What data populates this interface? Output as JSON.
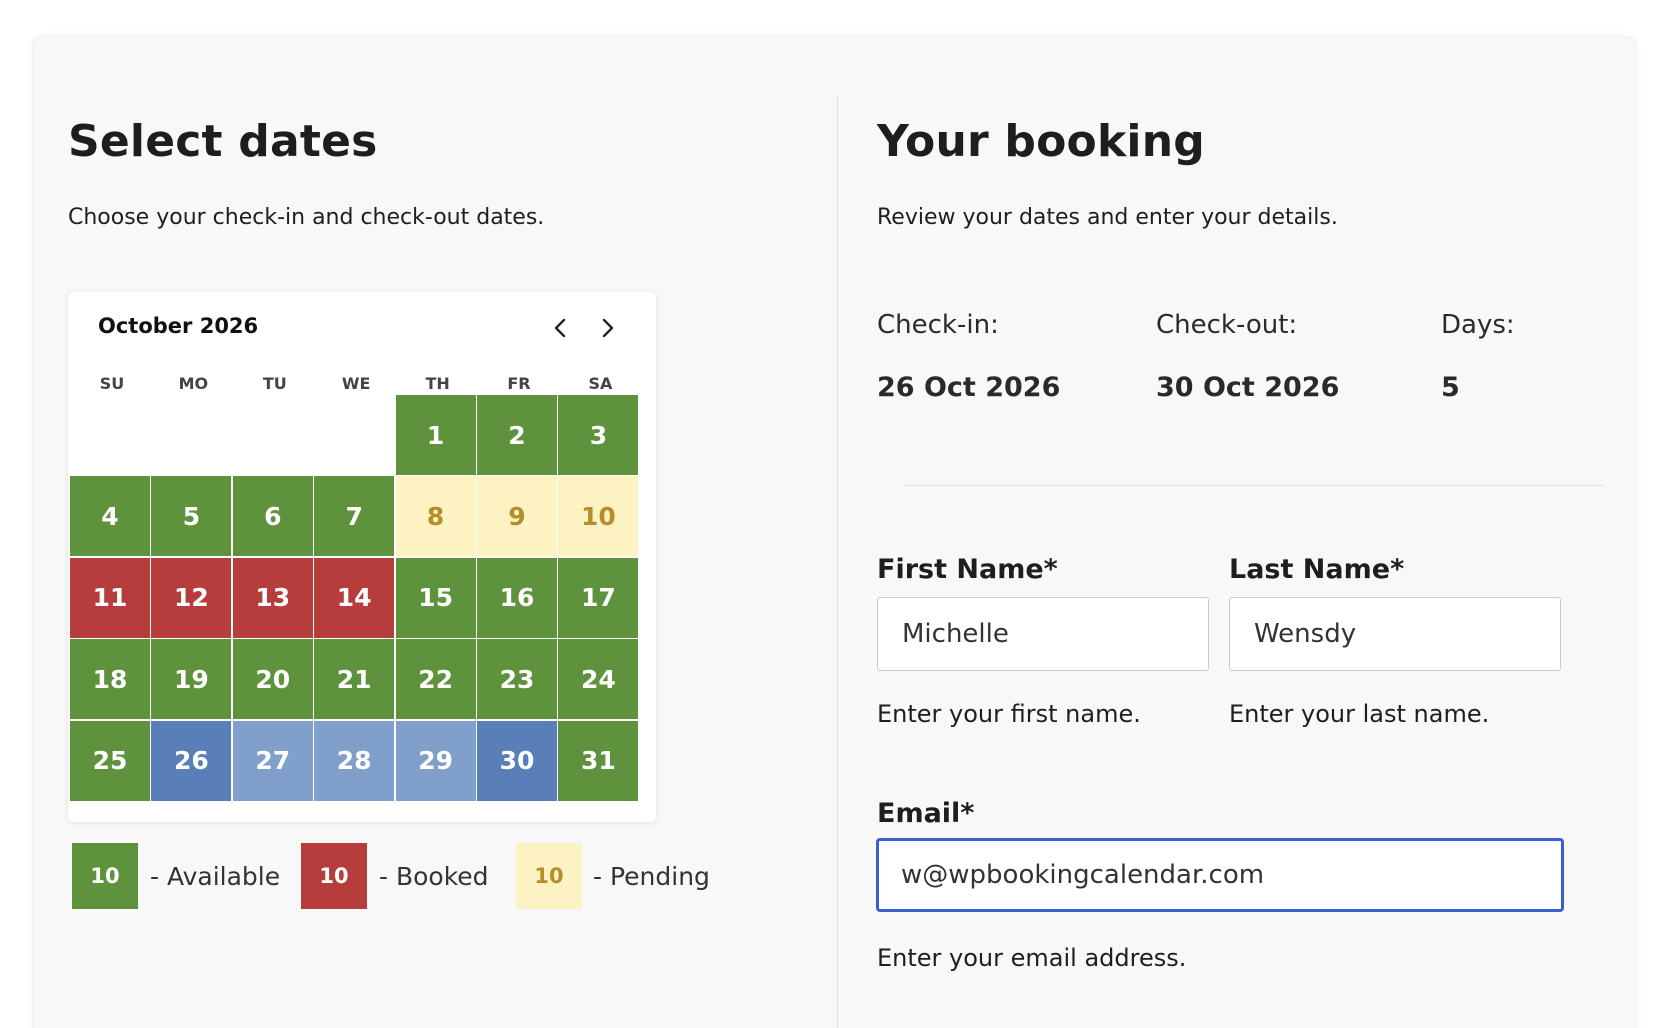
{
  "left": {
    "title": "Select dates",
    "subtitle": "Choose your check-in and check-out dates."
  },
  "calendar": {
    "month_label": "October 2026",
    "prev_icon": "chevron-left-icon",
    "next_icon": "chevron-right-icon",
    "weekdays": [
      "SU",
      "MO",
      "TU",
      "WE",
      "TH",
      "FR",
      "SA"
    ],
    "leading_blanks": 4,
    "days": [
      {
        "d": "1",
        "status": "available"
      },
      {
        "d": "2",
        "status": "available"
      },
      {
        "d": "3",
        "status": "available"
      },
      {
        "d": "4",
        "status": "available"
      },
      {
        "d": "5",
        "status": "available"
      },
      {
        "d": "6",
        "status": "available"
      },
      {
        "d": "7",
        "status": "available"
      },
      {
        "d": "8",
        "status": "pending"
      },
      {
        "d": "9",
        "status": "pending"
      },
      {
        "d": "10",
        "status": "pending"
      },
      {
        "d": "11",
        "status": "booked"
      },
      {
        "d": "12",
        "status": "booked"
      },
      {
        "d": "13",
        "status": "booked"
      },
      {
        "d": "14",
        "status": "booked"
      },
      {
        "d": "15",
        "status": "available"
      },
      {
        "d": "16",
        "status": "available"
      },
      {
        "d": "17",
        "status": "available"
      },
      {
        "d": "18",
        "status": "available"
      },
      {
        "d": "19",
        "status": "available"
      },
      {
        "d": "20",
        "status": "available"
      },
      {
        "d": "21",
        "status": "available"
      },
      {
        "d": "22",
        "status": "available"
      },
      {
        "d": "23",
        "status": "available"
      },
      {
        "d": "24",
        "status": "available"
      },
      {
        "d": "25",
        "status": "available"
      },
      {
        "d": "26",
        "status": "selected-start"
      },
      {
        "d": "27",
        "status": "selected"
      },
      {
        "d": "28",
        "status": "selected"
      },
      {
        "d": "29",
        "status": "selected"
      },
      {
        "d": "30",
        "status": "selected-end"
      },
      {
        "d": "31",
        "status": "available"
      }
    ]
  },
  "legend": [
    {
      "sample": "10",
      "label": "- Available",
      "status": "available"
    },
    {
      "sample": "10",
      "label": "- Booked",
      "status": "booked"
    },
    {
      "sample": "10",
      "label": "- Pending",
      "status": "pending"
    }
  ],
  "colors": {
    "available": "#5e923c",
    "booked": "#b73d3d",
    "pending": "#fdf3c2",
    "pending_text": "#b58d2b",
    "selected_edge": "#5a7fb8",
    "selected_mid": "#809fcb",
    "focus_border": "#3a5fd0"
  },
  "right": {
    "title": "Your booking",
    "subtitle": "Review your dates and enter your details.",
    "checkin_label": "Check-in:",
    "checkin_value": "26 Oct 2026",
    "checkout_label": "Check-out:",
    "checkout_value": "30 Oct 2026",
    "days_label": "Days:",
    "days_value": "5"
  },
  "form": {
    "first_name": {
      "label": "First Name*",
      "value": "Michelle",
      "help": "Enter your first name."
    },
    "last_name": {
      "label": "Last Name*",
      "value": "Wensdy",
      "help": "Enter your last name."
    },
    "email": {
      "label": "Email*",
      "value": "w@wpbookingcalendar.com",
      "help": "Enter your email address."
    }
  }
}
